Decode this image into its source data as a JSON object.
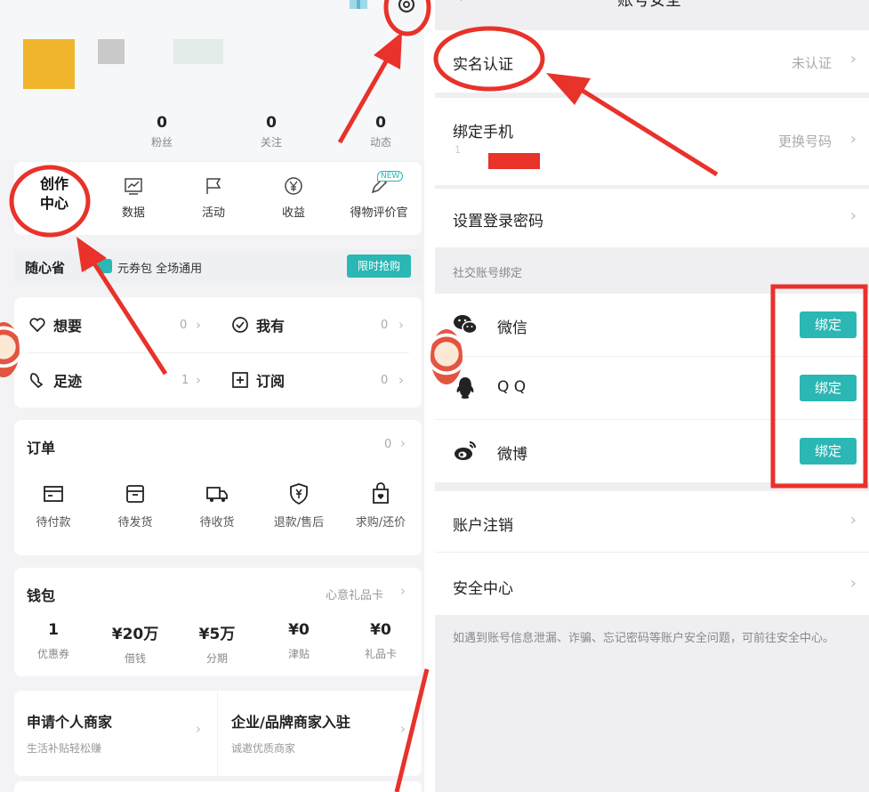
{
  "left": {
    "stats": [
      {
        "num": "0",
        "label": "粉丝"
      },
      {
        "num": "0",
        "label": "关注"
      },
      {
        "num": "0",
        "label": "动态"
      }
    ],
    "tools": {
      "main_line1": "创作",
      "main_line2": "中心",
      "items": [
        {
          "label": "数据"
        },
        {
          "label": "活动"
        },
        {
          "label": "收益"
        },
        {
          "label": "得物评价官"
        }
      ],
      "new_badge": "NEW"
    },
    "coupon": {
      "title": "随心省",
      "text": "元券包 全场通用",
      "button": "限时抢购"
    },
    "lists": {
      "want": {
        "label": "想要",
        "count": "0"
      },
      "have": {
        "label": "我有",
        "count": "0"
      },
      "footprint": {
        "label": "足迹",
        "count": "1"
      },
      "subscribe": {
        "label": "订阅",
        "count": "0"
      }
    },
    "orders": {
      "title": "订单",
      "count": "0",
      "items": [
        {
          "label": "待付款"
        },
        {
          "label": "待发货"
        },
        {
          "label": "待收货"
        },
        {
          "label": "退款/售后"
        },
        {
          "label": "求购/还价"
        }
      ]
    },
    "wallet": {
      "title": "钱包",
      "link": "心意礼品卡",
      "items": [
        {
          "value": "1",
          "label": "优惠券"
        },
        {
          "value": "¥20万",
          "label": "借钱"
        },
        {
          "value": "¥5万",
          "label": "分期"
        },
        {
          "value": "¥0",
          "label": "津贴"
        },
        {
          "value": "¥0",
          "label": "礼品卡"
        }
      ]
    },
    "merchant": {
      "personal_title": "申请个人商家",
      "personal_sub": "生活补贴轻松赚",
      "enterprise_title": "企业/品牌商家入驻",
      "enterprise_sub": "诚邀优质商家"
    }
  },
  "right": {
    "title": "账号安全",
    "realname": {
      "label": "实名认证",
      "value": "未认证"
    },
    "phone": {
      "label": "绑定手机",
      "value": "更换号码",
      "partial": "1"
    },
    "password": {
      "label": "设置登录密码"
    },
    "social_section": "社交账号绑定",
    "social": [
      {
        "label": "微信",
        "button": "绑定"
      },
      {
        "label": "Q Q",
        "button": "绑定"
      },
      {
        "label": "微博",
        "button": "绑定"
      }
    ],
    "cancel": {
      "label": "账户注销"
    },
    "security_center": {
      "label": "安全中心"
    },
    "notice": "如遇到账号信息泄漏、诈骗、忘记密码等账户安全问题，可前往安全中心。"
  },
  "colors": {
    "accent": "#2bb7b4",
    "annotation": "#e8322a",
    "avatar": "#f0b52a"
  }
}
